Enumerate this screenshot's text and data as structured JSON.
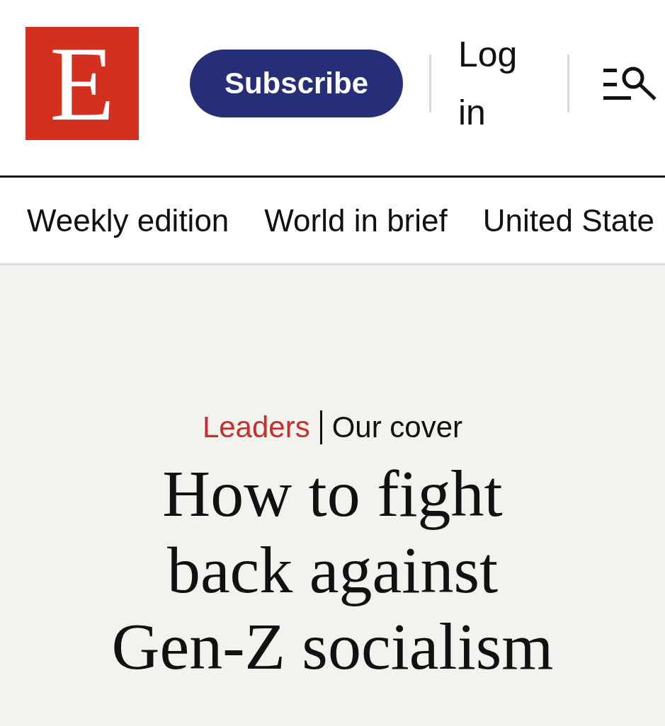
{
  "header": {
    "logo": "E",
    "subscribe_button": "Subscribe",
    "login_link": "Log in"
  },
  "nav": {
    "items": [
      {
        "label": "Weekly edition"
      },
      {
        "label": "World in brief"
      },
      {
        "label": "United State"
      }
    ]
  },
  "article": {
    "section": "Leaders",
    "rubric": "Our cover",
    "headline": "How to fight back against Gen-Z socialism"
  }
}
